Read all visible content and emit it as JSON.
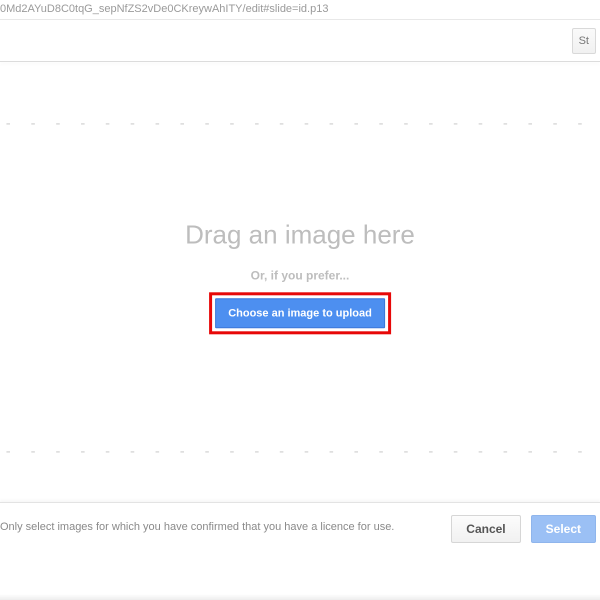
{
  "url_fragment": "0Md2AYuD8C0tqG_sepNfZS2vDe0CKreywAhITY/edit#slide=id.p13",
  "toolbar": {
    "right_btn": "St"
  },
  "dropzone": {
    "dash_line": "- - - - - - - - - - - - - - - - - - - - - - - - - - - - - - - - - - - - - - - - - - - - - - - - - -",
    "title": "Drag an image here",
    "subtitle": "Or, if you prefer...",
    "upload_label": "Choose an image to upload"
  },
  "footer": {
    "licence_text": "Only select images for which you have confirmed that you have a licence for use.",
    "cancel": "Cancel",
    "select": "Select"
  }
}
